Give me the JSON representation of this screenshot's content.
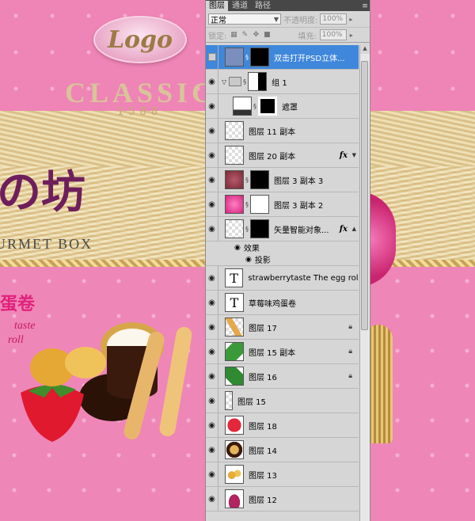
{
  "artwork": {
    "logo": "Logo",
    "classic": "CLASSIC",
    "year": "1588",
    "brand": "の坊",
    "gourmet": "URMET BOX",
    "egg": "蛋卷",
    "taste_line1": "taste",
    "taste_line2": "roll"
  },
  "panel": {
    "tabs": [
      "图层",
      "通道",
      "路径"
    ],
    "blend_mode": "正常",
    "opacity_label": "不透明度:",
    "opacity_value": "100%",
    "lock_label": "锁定:",
    "fill_label": "填充:",
    "fill_value": "100%",
    "layers": [
      {
        "name": "双击打开PSD立体...",
        "selected": true
      },
      {
        "name": "组 1"
      },
      {
        "name": "遮罩"
      },
      {
        "name": "图层 11 副本"
      },
      {
        "name": "图层 20 副本",
        "fx": "fx"
      },
      {
        "name": "图层 3 副本 3"
      },
      {
        "name": "图层 3 副本 2"
      },
      {
        "name": "矢量智能对象...",
        "fx": "fx"
      },
      {
        "name": "效果"
      },
      {
        "name": "投影"
      },
      {
        "name": "strawberrytaste  The egg roll"
      },
      {
        "name": "草莓味鸡蛋卷"
      },
      {
        "name": "图层 17"
      },
      {
        "name": "图层 15 副本"
      },
      {
        "name": "图层 16"
      },
      {
        "name": "图层 15"
      },
      {
        "name": "图层 18"
      },
      {
        "name": "图层 14"
      },
      {
        "name": "图层 13"
      },
      {
        "name": "图层 12"
      }
    ],
    "text_thumb": "T"
  }
}
